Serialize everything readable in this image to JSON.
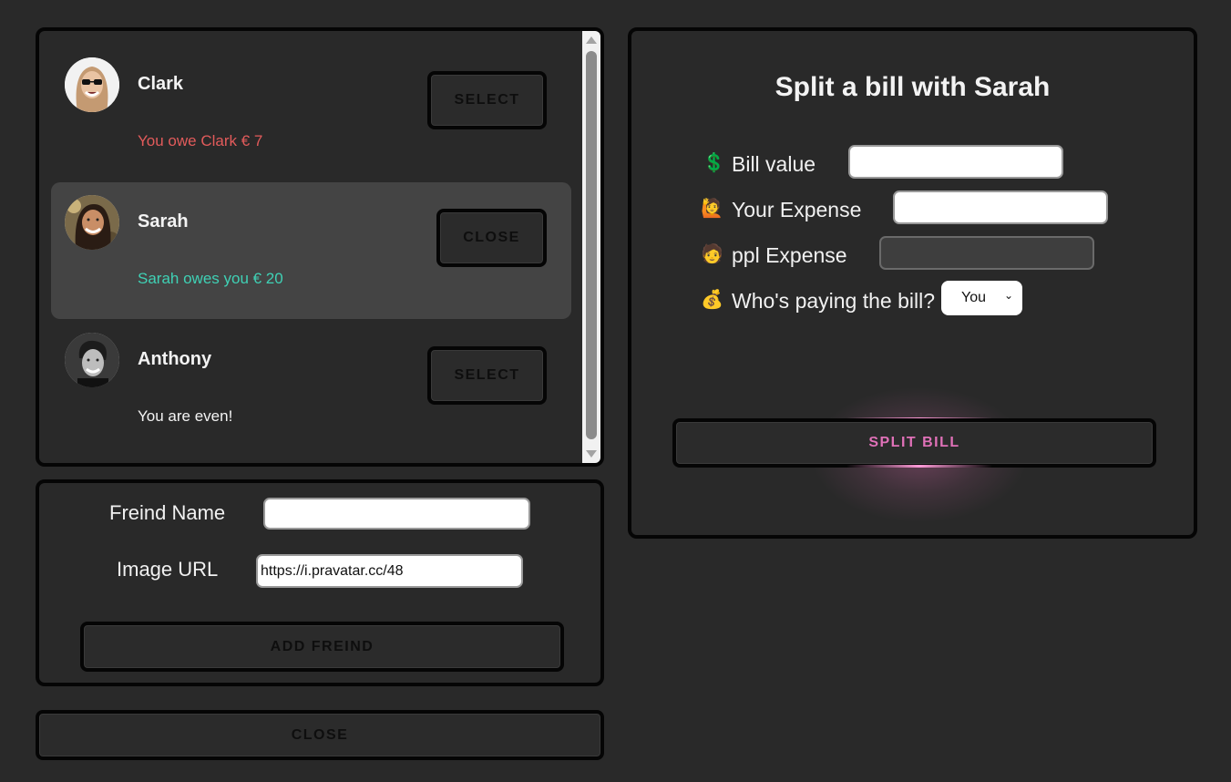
{
  "friends": [
    {
      "name": "Clark",
      "status": "You owe Clark € 7",
      "button": "SELECT",
      "tone": "owe",
      "selected": false,
      "avatar_icon": "clark-avatar"
    },
    {
      "name": "Sarah",
      "status": "Sarah owes you € 20",
      "button": "CLOSE",
      "tone": "owed",
      "selected": true,
      "avatar_icon": "sarah-avatar"
    },
    {
      "name": "Anthony",
      "status": "You are even!",
      "button": "SELECT",
      "tone": "even",
      "selected": false,
      "avatar_icon": "anthony-avatar"
    }
  ],
  "add_friend": {
    "name_label": "Freind Name",
    "name_value": "",
    "image_label": "Image URL",
    "image_value": "https://i.pravatar.cc/48",
    "button": "ADD FREIND"
  },
  "close_button": "CLOSE",
  "split": {
    "title": "Split a bill with Sarah",
    "bill_icon": "💲",
    "bill_label": "Bill value",
    "bill_value": "",
    "your_icon": "🙋",
    "your_label": "Your Expense",
    "your_value": "",
    "ppl_icon": "🧑",
    "ppl_label": "ppl Expense",
    "ppl_value": "",
    "payer_icon": "💰",
    "payer_label": "Who's paying the bill?",
    "payer_selected": "You",
    "button": "SPLIT BILL"
  },
  "colors": {
    "background": "#292929",
    "owe": "#e25b5b",
    "owed": "#3fd1b5",
    "accent": "#e071b8"
  }
}
